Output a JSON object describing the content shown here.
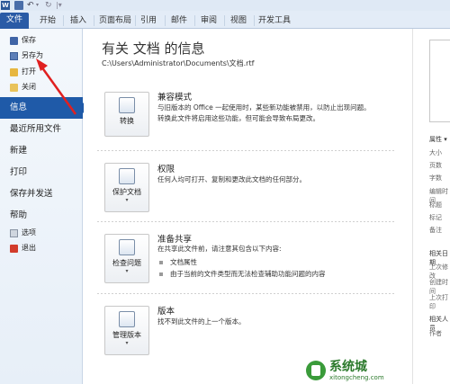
{
  "quick_access": {
    "word_icon": "W",
    "icons": [
      "word-icon",
      "save-icon",
      "undo-icon",
      "redo-icon"
    ]
  },
  "ribbon_tabs": [
    "文件",
    "开始",
    "插入",
    "页面布局",
    "引用",
    "邮件",
    "审阅",
    "视图",
    "开发工具"
  ],
  "nav": {
    "small_top": [
      {
        "label": "保存",
        "icon": "save-icon"
      },
      {
        "label": "另存为",
        "icon": "save-as-icon"
      },
      {
        "label": "打开",
        "icon": "open-folder-icon"
      },
      {
        "label": "关闭",
        "icon": "close-file-icon"
      }
    ],
    "big": [
      "信息",
      "最近所用文件",
      "新建",
      "打印",
      "保存并发送",
      "帮助"
    ],
    "active": "信息",
    "small_bottom": [
      {
        "label": "选项",
        "icon": "options-icon"
      },
      {
        "label": "退出",
        "icon": "exit-icon"
      }
    ]
  },
  "main": {
    "title": "有关 文档 的信息",
    "path": "C:\\Users\\Administrator\\Documents\\文档.rtf",
    "sections": [
      {
        "button": "转换",
        "title": "兼容模式",
        "desc": "与旧版本的 Office 一起使用时，某些新功能被禁用，以防止出现问题。转换此文件将启用这些功能，但可能会导致布局更改。",
        "icon": "convert-icon"
      },
      {
        "button": "保护文档",
        "title": "权限",
        "desc": "任何人均可打开、复制和更改此文档的任何部分。",
        "icon": "protect-icon"
      },
      {
        "button": "检查问题",
        "title": "准备共享",
        "desc": "在共享此文件前，请注意其包含以下内容:",
        "bullets": [
          "文档属性",
          "由于当前的文件类型而无法检查辅助功能问题的内容"
        ],
        "icon": "check-issues-icon"
      },
      {
        "button": "管理版本",
        "title": "版本",
        "desc": "找不到此文件的上一个版本。",
        "icon": "manage-versions-icon"
      }
    ]
  },
  "right_panel": {
    "props_head": "属性 ▾",
    "props": [
      "大小",
      "页数",
      "字数",
      "编辑时间",
      "标题",
      "标记",
      "备注"
    ],
    "related_dates": "相关日期",
    "dates": [
      "上次修改",
      "创建时间",
      "上次打印"
    ],
    "related_people": "相关人员",
    "people": [
      "作者"
    ]
  },
  "watermark": {
    "title": "系统城",
    "url": "xitongcheng.com"
  }
}
